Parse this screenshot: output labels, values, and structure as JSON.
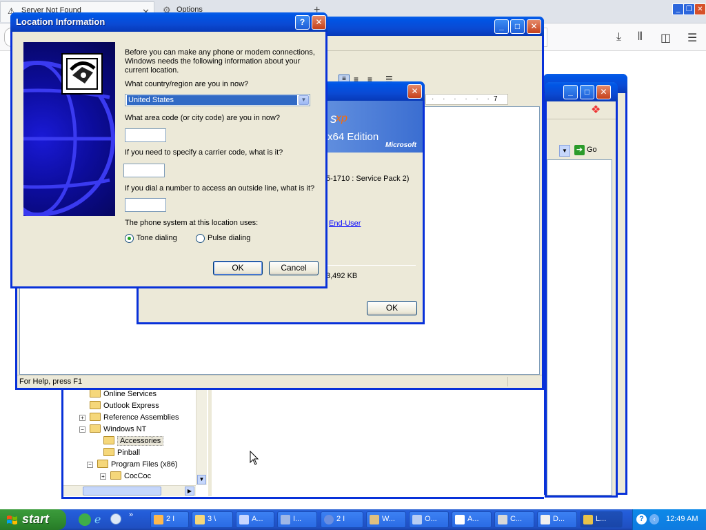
{
  "browser": {
    "tabs": [
      {
        "label": "Server Not Found"
      },
      {
        "label": "Options"
      }
    ],
    "new_tab": "+"
  },
  "wordpad": {
    "status": "For Help, press F1",
    "ruler_mark": "7"
  },
  "about_dialog": {
    "os_xp": "xp",
    "edition": "x64 Edition",
    "brand": "Microsoft",
    "version": "5-1710 : Service Pack 2)",
    "link": "End-User",
    "memory": "3,492 KB",
    "ok": "OK"
  },
  "ie_window": {
    "go": "Go"
  },
  "explorer": {
    "tree": [
      {
        "label": "Online Services",
        "indent": 2,
        "expander": ""
      },
      {
        "label": "Outlook Express",
        "indent": 2,
        "expander": ""
      },
      {
        "label": "Reference Assemblies",
        "indent": 2,
        "expander": "+"
      },
      {
        "label": "Windows NT",
        "indent": 2,
        "expander": "−"
      },
      {
        "label": "Accessories",
        "indent": 3,
        "expander": "",
        "selected": true
      },
      {
        "label": "Pinball",
        "indent": 3,
        "expander": ""
      },
      {
        "label": "Program Files (x86)",
        "indent": 1,
        "expander": "−"
      },
      {
        "label": "CocCoc",
        "indent": 2,
        "expander": "+"
      }
    ]
  },
  "location_dialog": {
    "title": "Location Information",
    "intro": "Before you can make any phone or modem connections, Windows needs the following information about your current location.",
    "country_label": "What country/region are you in now?",
    "country_value": "United States",
    "area_label": "What area code (or city code) are you in now?",
    "area_value": "",
    "carrier_label": "If you need to specify a carrier code, what is it?",
    "carrier_value": "",
    "outside_label": "If you dial a number to access an outside line, what is it?",
    "outside_value": "",
    "phone_system_label": "The phone system at this location uses:",
    "tone": "Tone dialing",
    "pulse": "Pulse dialing",
    "ok": "OK",
    "cancel": "Cancel",
    "help_btn": "?",
    "close_btn": "✕"
  },
  "taskbar": {
    "start": "start",
    "tasks": [
      {
        "label": "2 I"
      },
      {
        "label": "3 \\"
      },
      {
        "label": "A..."
      },
      {
        "label": "I..."
      },
      {
        "label": "2 I"
      },
      {
        "label": "W..."
      },
      {
        "label": "O..."
      },
      {
        "label": "A..."
      },
      {
        "label": "C..."
      },
      {
        "label": "D..."
      },
      {
        "label": "L..."
      }
    ],
    "clock": "12:49 AM"
  },
  "colors": {
    "xp_blue": "#0831d9",
    "selection": "#316ac5",
    "start_green": "#2f8a2f"
  }
}
